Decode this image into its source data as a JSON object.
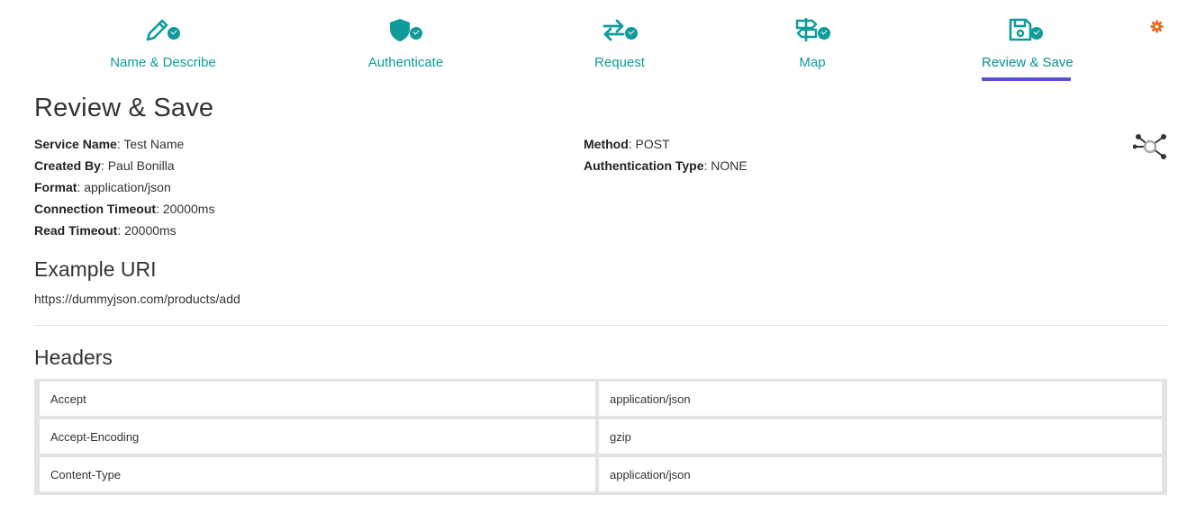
{
  "stepper": {
    "steps": [
      {
        "label": "Name & Describe",
        "icon": "pencil-icon"
      },
      {
        "label": "Authenticate",
        "icon": "shield-icon"
      },
      {
        "label": "Request",
        "icon": "swap-arrows-icon"
      },
      {
        "label": "Map",
        "icon": "signpost-icon"
      },
      {
        "label": "Review & Save",
        "icon": "floppy-disk-icon",
        "active": true
      }
    ],
    "accent_color": "#0f9b9b",
    "active_underline_color": "#5b4fd8"
  },
  "settings_icon": {
    "icon": "gear-icon",
    "color": "#e8691c"
  },
  "page_title": "Review & Save",
  "details_left": [
    {
      "label": "Service Name",
      "value": ": Test Name"
    },
    {
      "label": "Created By",
      "value": ": Paul Bonilla"
    },
    {
      "label": "Format",
      "value": ": application/json"
    },
    {
      "label": "Connection Timeout",
      "value": ": 20000ms"
    },
    {
      "label": "Read Timeout",
      "value": ": 20000ms"
    }
  ],
  "details_right": [
    {
      "label": "Method",
      "value": ": POST"
    },
    {
      "label": "Authentication Type",
      "value": ": NONE"
    }
  ],
  "network_icon": "network-graph-icon",
  "example_uri": {
    "title": "Example URI",
    "value": "https://dummyjson.com/products/add"
  },
  "headers": {
    "title": "Headers",
    "rows": [
      {
        "key": "Accept",
        "value": "application/json"
      },
      {
        "key": "Accept-Encoding",
        "value": "gzip"
      },
      {
        "key": "Content-Type",
        "value": "application/json"
      }
    ]
  }
}
